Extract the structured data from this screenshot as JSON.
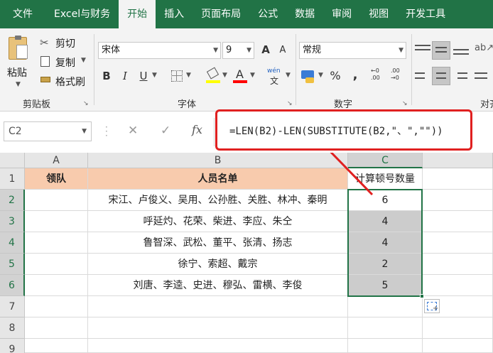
{
  "tabs": [
    "文件",
    "Excel与财务",
    "开始",
    "插入",
    "页面布局",
    "公式",
    "数据",
    "审阅",
    "视图",
    "开发工具"
  ],
  "clipboard": {
    "paste": "粘贴",
    "cut": "剪切",
    "copy": "复制",
    "painter": "格式刷",
    "label": "剪贴板"
  },
  "font": {
    "name": "宋体",
    "size": "9",
    "label": "字体",
    "bold": "B",
    "italic": "I",
    "underline": "U",
    "grow": "A",
    "shrink": "A",
    "fontcolor": "A",
    "wen": "wén"
  },
  "number": {
    "format": "常规",
    "label": "数字",
    "percent": "%",
    "comma": ","
  },
  "alignment": {
    "label": "对齐"
  },
  "formula_bar": {
    "namebox": "C2",
    "cancel": "✕",
    "enter": "✓",
    "fx": "fx",
    "formula": "=LEN(B2)-LEN(SUBSTITUTE(B2,\"、\",\"\"))"
  },
  "columns": [
    "A",
    "B",
    "C"
  ],
  "rows": [
    "1",
    "2",
    "3",
    "4",
    "5",
    "6",
    "7",
    "8",
    "9"
  ],
  "header": {
    "a": "领队",
    "b": "人员名单",
    "c": "计算顿号数量"
  },
  "data": [
    {
      "b": "宋江、卢俊义、吴用、公孙胜、关胜、林冲、秦明",
      "c": "6"
    },
    {
      "b": "呼延灼、花荣、柴进、李应、朱仝",
      "c": "4"
    },
    {
      "b": "鲁智深、武松、董平、张清、扬志",
      "c": "4"
    },
    {
      "b": "徐宁、索超、戴宗",
      "c": "2"
    },
    {
      "b": "刘唐、李逵、史进、穆弘、雷横、李俊",
      "c": "5"
    }
  ],
  "colors": {
    "ribbon": "#217346",
    "header_fill": "#f8cbad",
    "selection": "#cccccc",
    "callout": "#e02020"
  }
}
